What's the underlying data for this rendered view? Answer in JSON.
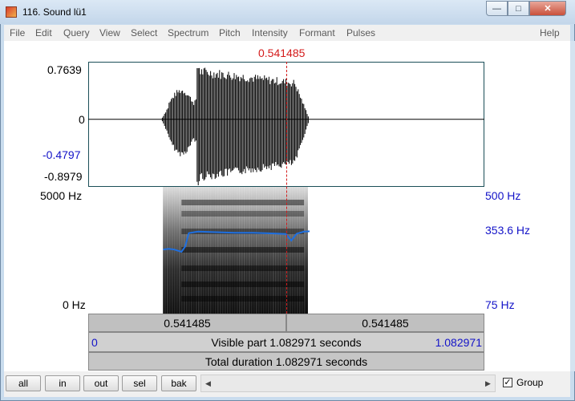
{
  "window": {
    "title": "116. Sound lü1",
    "minimize_glyph": "—",
    "maximize_glyph": "□",
    "close_glyph": "✕"
  },
  "menu": [
    "File",
    "Edit",
    "Query",
    "View",
    "Select",
    "Spectrum",
    "Pitch",
    "Intensity",
    "Formant",
    "Pulses",
    "Help"
  ],
  "cursor_time": "0.541485",
  "waveform": {
    "y_labels": {
      "max": "0.7639",
      "zero": "0",
      "marker": "-0.4797",
      "min": "-0.8979"
    },
    "y_range": [
      -0.8979,
      0.7639
    ],
    "start_time": 0.2,
    "end_time": 0.605
  },
  "spectrogram": {
    "freq_top": "5000 Hz",
    "freq_bottom": "0 Hz",
    "pitch_top": "500 Hz",
    "pitch_current": "353.6 Hz",
    "pitch_bottom": "75 Hz",
    "pitch_range": [
      75,
      500
    ],
    "pitch_track": [
      [
        0.205,
        290
      ],
      [
        0.22,
        292
      ],
      [
        0.235,
        290
      ],
      [
        0.245,
        286
      ],
      [
        0.255,
        282
      ],
      [
        0.265,
        300
      ],
      [
        0.275,
        345
      ],
      [
        0.3,
        350
      ],
      [
        0.35,
        348
      ],
      [
        0.4,
        346
      ],
      [
        0.45,
        346
      ],
      [
        0.5,
        344
      ],
      [
        0.54,
        342
      ],
      [
        0.555,
        320
      ],
      [
        0.57,
        343
      ],
      [
        0.59,
        350
      ],
      [
        0.605,
        351
      ]
    ]
  },
  "total_duration_s": 1.082971,
  "selection": {
    "left": "0.541485",
    "right": "0.541485"
  },
  "visible": {
    "start": "0",
    "label": "Visible part 1.082971 seconds",
    "end": "1.082971"
  },
  "total": {
    "label": "Total duration 1.082971 seconds"
  },
  "toolbar": {
    "buttons": [
      "all",
      "in",
      "out",
      "sel",
      "bak"
    ],
    "group_label": "Group",
    "group_checked": true,
    "left_arrow": "◀",
    "right_arrow": "▶"
  },
  "colors": {
    "cursor": "#d41c1c",
    "pitch": "#1e6fe0",
    "axis_blue": "#1313c8",
    "frame_border": "#1b4f58"
  }
}
